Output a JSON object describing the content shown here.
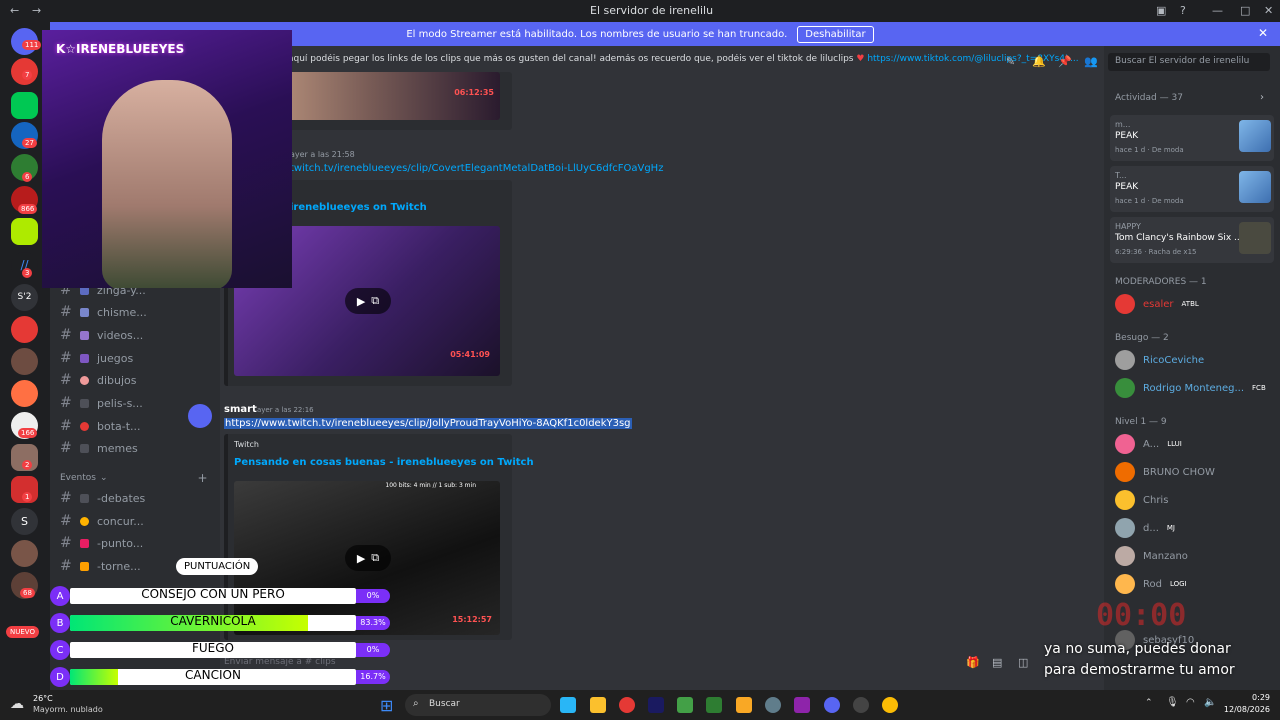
{
  "window": {
    "title": "El servidor de irenelilu"
  },
  "banner": {
    "text": "El modo Streamer está habilitado. Los nombres de usuario se han truncado.",
    "button": "Deshabilitar"
  },
  "guild_badges": [
    "111",
    "7",
    "27",
    "6",
    "866",
    "3",
    "S'2",
    "166",
    "2",
    "2",
    "1",
    "S",
    "68",
    "NUEVO"
  ],
  "channel_topic": {
    "text": "aquí podéis pegar los links de los clips que más os gusten del canal! además os recuerdo que, podéis ver el tiktok de liluclips",
    "link": "https://www.tiktok.com/@liluclips?_t=8XYs4L..."
  },
  "search": {
    "placeholder": "Buscar El servidor de irenelilu"
  },
  "channels": [
    {
      "name": "zinga-y..."
    },
    {
      "name": "chisme..."
    },
    {
      "name": "videos..."
    },
    {
      "name": "juegos"
    },
    {
      "name": "dibujos"
    },
    {
      "name": "pelis-s..."
    },
    {
      "name": "bota-t..."
    },
    {
      "name": "memes"
    }
  ],
  "events_category": "Eventos",
  "event_channels": [
    {
      "name": "-debates"
    },
    {
      "name": "concur..."
    },
    {
      "name": "-punto..."
    },
    {
      "name": "-torne..."
    }
  ],
  "messages": {
    "m1_video_time": "06:12:35",
    "m2_time": "ayer a las 21:58",
    "m2_link": "twitch.tv/ireneblueeyes/clip/CovertElegantMetalDatBoi-LlUyC6dfcFOaVgHz",
    "m2_embed_title": "ireneblueeyes on Twitch",
    "m2_video_time": "05:41:09",
    "m3_author": "smart",
    "m3_time": "ayer a las 22:16",
    "m3_link": "https://www.twitch.tv/ireneblueeyes/clip/JollyProudTrayVoHiYo-8AQKf1c0ldekY3sg",
    "m3_provider": "Twitch",
    "m3_embed_title": "Pensando en cosas buenas - ireneblueeyes on Twitch",
    "m3_video_caption": "100 bits: 4 min // 1 sub: 3 min",
    "m3_video_time": "15:12:57"
  },
  "composer": {
    "placeholder": "Enviar mensaje a # clips"
  },
  "members": {
    "activity_header": "Actividad — 37",
    "activities": [
      {
        "user": "m...",
        "game": "PEAK",
        "meta": "hace 1 d · De moda"
      },
      {
        "user": "T...",
        "game": "PEAK",
        "meta": "hace 1 d · De moda"
      },
      {
        "user": "HAPPY",
        "game": "Tom Clancy's Rainbow Six ...",
        "meta": "6:29:36 · Racha de x15"
      }
    ],
    "mods_header": "MODERADORES — 1",
    "mods": [
      {
        "name": "esaler",
        "tag": "ATBL"
      }
    ],
    "besugo_header": "Besugo — 2",
    "besugo": [
      {
        "name": "RicoCeviche",
        "tag": ""
      },
      {
        "name": "Rodrigo Monteneg...",
        "tag": "FCB"
      }
    ],
    "nivel_header": "Nivel 1 — 9",
    "nivel": [
      {
        "name": "A...",
        "tag": "LLUI"
      },
      {
        "name": "BRUNO CHOW",
        "tag": ""
      },
      {
        "name": "Chris",
        "tag": ""
      },
      {
        "name": "d...",
        "tag": "MJ"
      },
      {
        "name": "Manzano",
        "tag": ""
      },
      {
        "name": "Rod",
        "tag": "LOGI"
      },
      {
        "name": "sebasyf10",
        "tag": ""
      }
    ]
  },
  "overlay": {
    "webcam_tag": "K☆IRENEBLUEEYES",
    "timer": "00:00",
    "donation_note_1": "ya no suma, puedes donar",
    "donation_note_2": "para demostrarme tu amor",
    "poll_title": "PUNTUACIÓN",
    "poll": [
      {
        "letter": "A",
        "label": "CONSEJO CON UN PERO",
        "pct": "0%",
        "fraction": 0.0
      },
      {
        "letter": "B",
        "label": "CAVERNICOLA",
        "pct": "83.3%",
        "fraction": 0.833
      },
      {
        "letter": "C",
        "label": "FUEGO",
        "pct": "0%",
        "fraction": 0.0
      },
      {
        "letter": "D",
        "label": "CANCION",
        "pct": "16.7%",
        "fraction": 0.167
      }
    ]
  },
  "taskbar": {
    "weather_temp": "26°C",
    "weather_desc": "Mayorm. nublado",
    "search": "Buscar",
    "time": "0:29",
    "date": "12/08/2026"
  }
}
